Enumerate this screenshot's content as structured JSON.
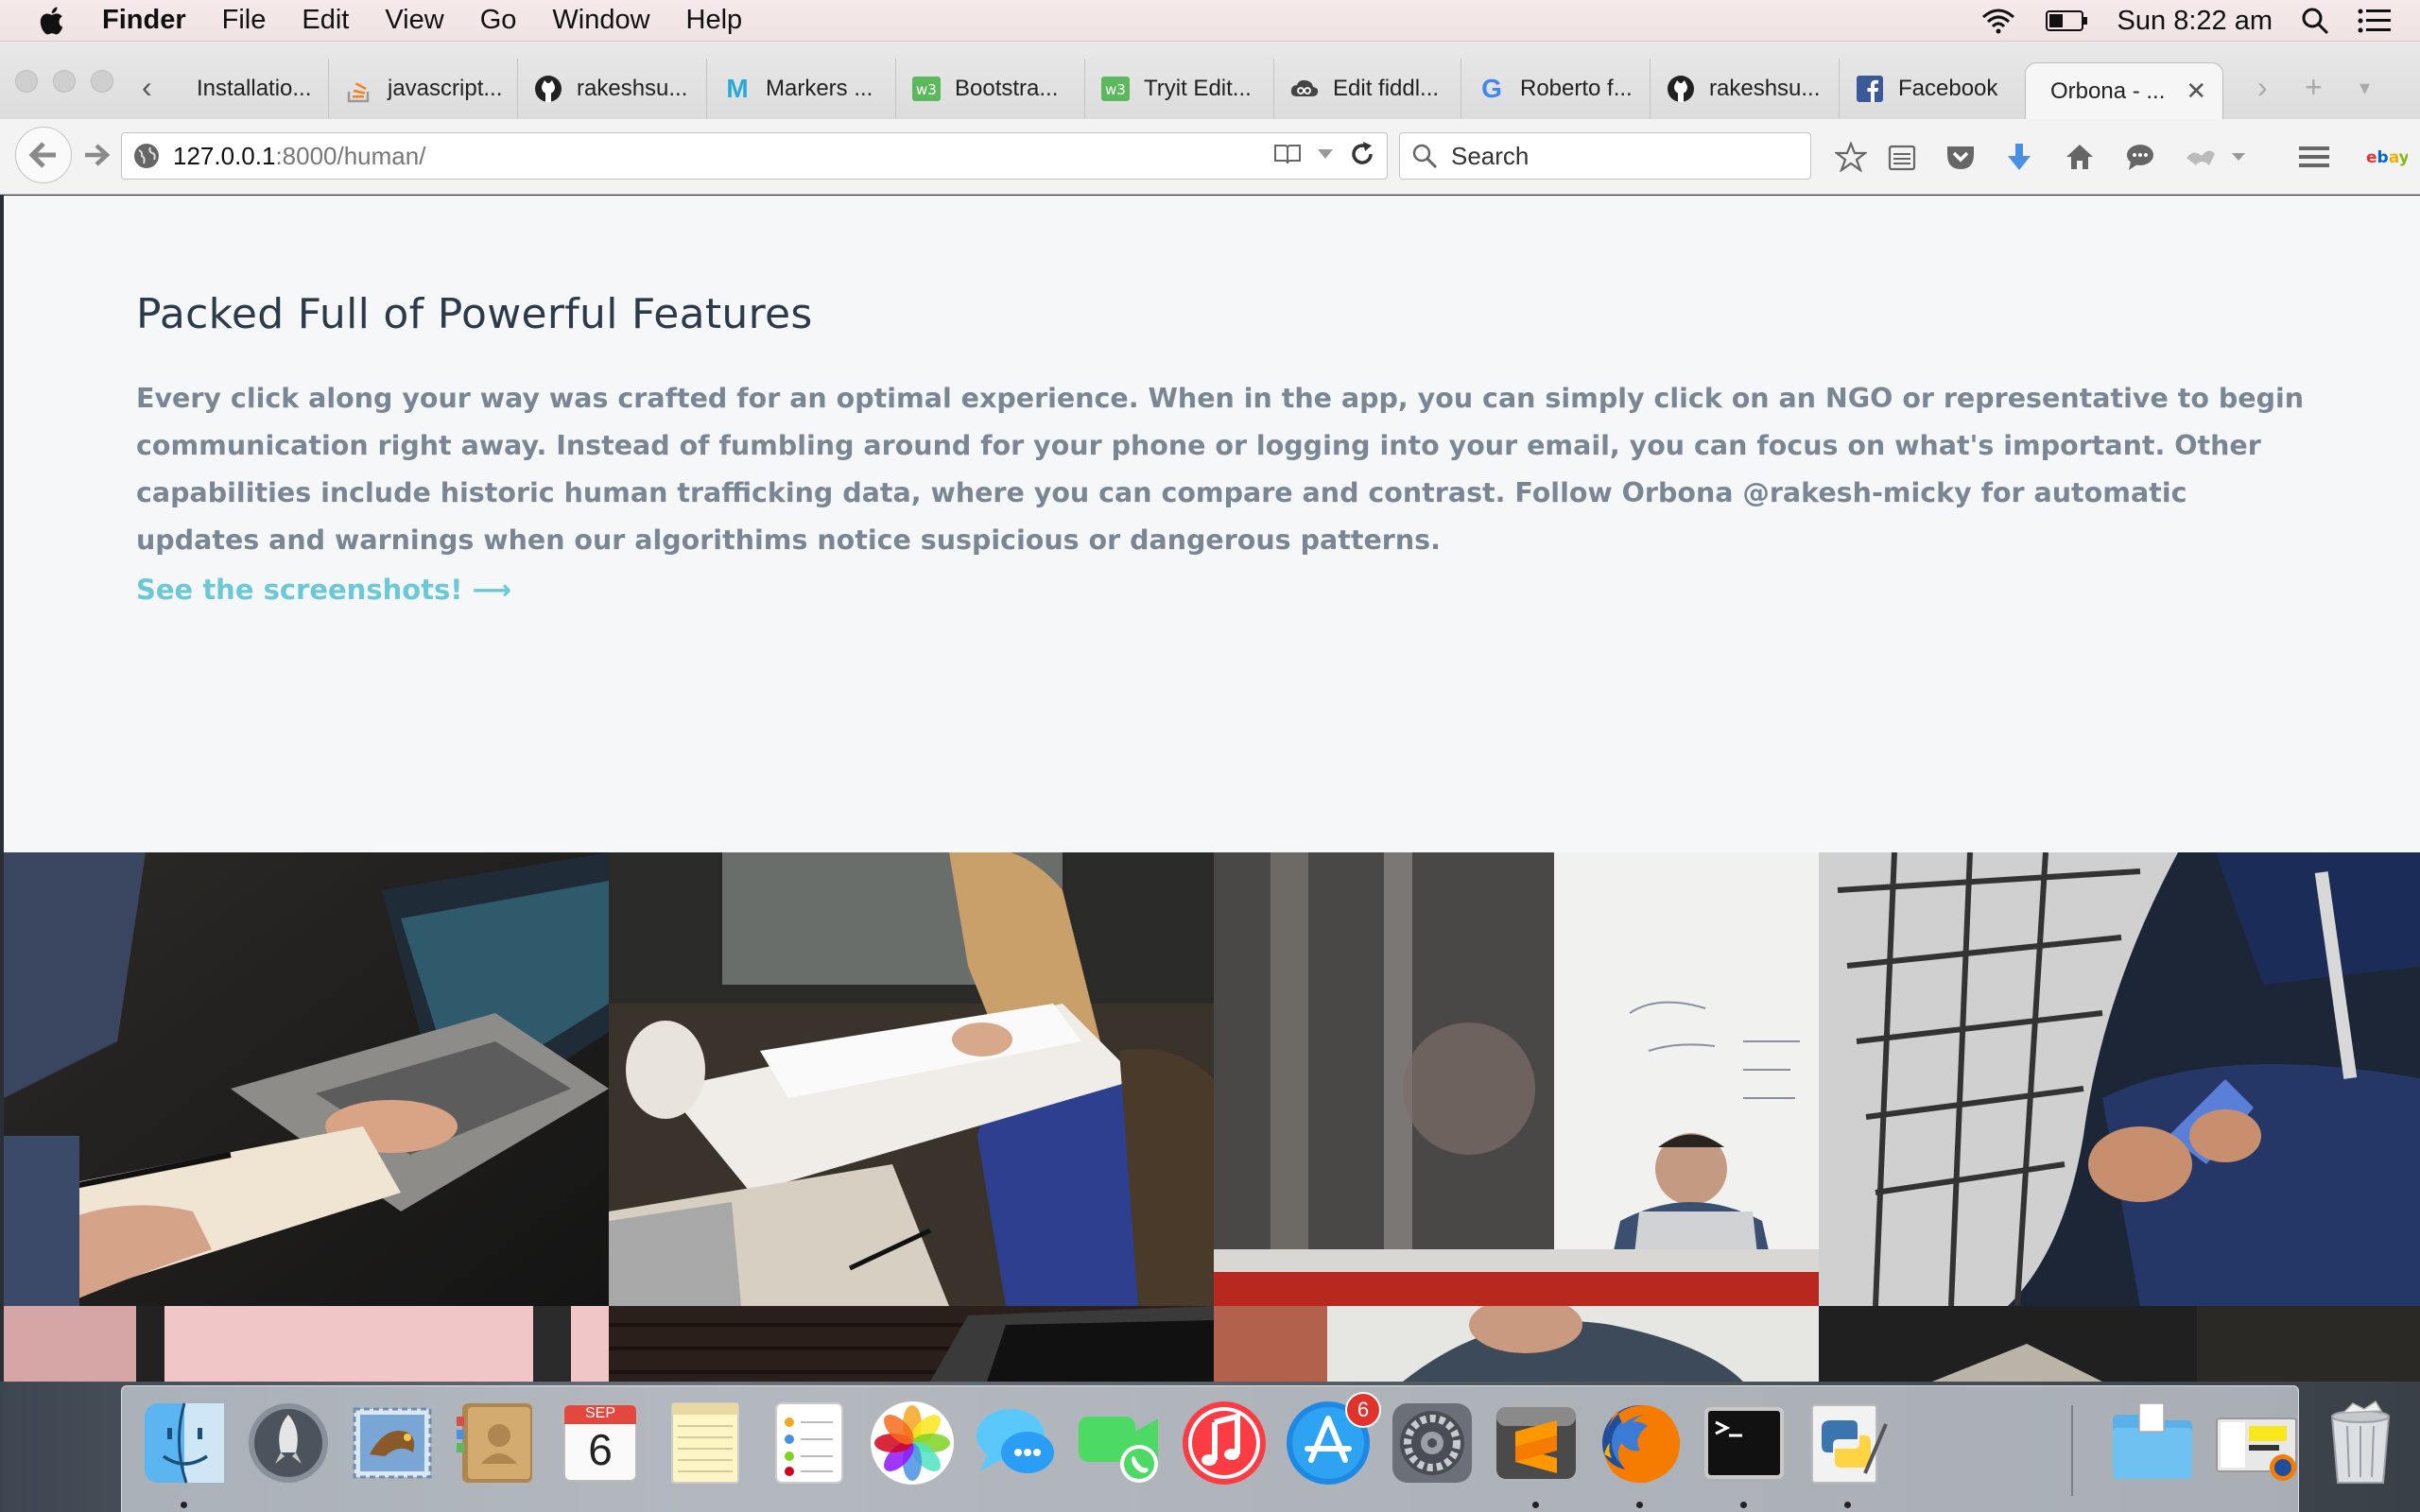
{
  "menubar": {
    "app_name": "Finder",
    "items": [
      "File",
      "Edit",
      "View",
      "Go",
      "Window",
      "Help"
    ],
    "clock": "Sun 8:22 am"
  },
  "browser": {
    "tabs": [
      {
        "label": "Installatio...",
        "icon": "document-icon"
      },
      {
        "label": "javascript...",
        "icon": "stackoverflow-icon"
      },
      {
        "label": "rakeshsu...",
        "icon": "github-icon"
      },
      {
        "label": "Markers ...",
        "icon": "m-logo-icon"
      },
      {
        "label": "Bootstra...",
        "icon": "w3schools-icon"
      },
      {
        "label": "Tryit Edit...",
        "icon": "w3schools-icon"
      },
      {
        "label": "Edit fiddl...",
        "icon": "jsfiddle-icon"
      },
      {
        "label": "Roberto f...",
        "icon": "google-icon"
      },
      {
        "label": "rakeshsu...",
        "icon": "github-icon"
      },
      {
        "label": "Facebook",
        "icon": "facebook-icon"
      },
      {
        "label": "Orbona - ...",
        "icon": "none",
        "active": true
      }
    ],
    "url_host": "127.0.0.1",
    "url_path": ":8000/human/",
    "search_placeholder": "Search"
  },
  "page": {
    "heading": "Packed Full of Powerful Features",
    "paragraph": "Every click along your way was crafted for an optimal experience. When in the app, you can simply click on an NGO or representative to begin communication right away. Instead of fumbling around for your phone or logging into your email, you can focus on what's important. Other capabilities include historic human trafficking data, where you can compare and contrast. Follow Orbona @rakesh-micky for automatic updates and warnings when our algorithims notice suspicious or dangerous patterns.",
    "link_text": "See the screenshots! ⟶",
    "gallery_photos": [
      "laptop-and-notebook-photo",
      "woman-writing-notes-photo",
      "man-at-whiteboard-photo",
      "person-using-phone-photo"
    ]
  },
  "dock": {
    "apps": [
      "Finder",
      "Launchpad",
      "Mail",
      "Contacts",
      "Calendar",
      "Notes",
      "Reminders",
      "Photos",
      "Messages",
      "FaceTime",
      "iTunes",
      "App Store",
      "System Preferences",
      "Sublime Text",
      "Firefox",
      "Terminal",
      "Python Launcher",
      "Downloads",
      "Documents",
      "Trash"
    ],
    "calendar_month": "SEP",
    "calendar_day": "6",
    "app_store_badge": "6"
  }
}
